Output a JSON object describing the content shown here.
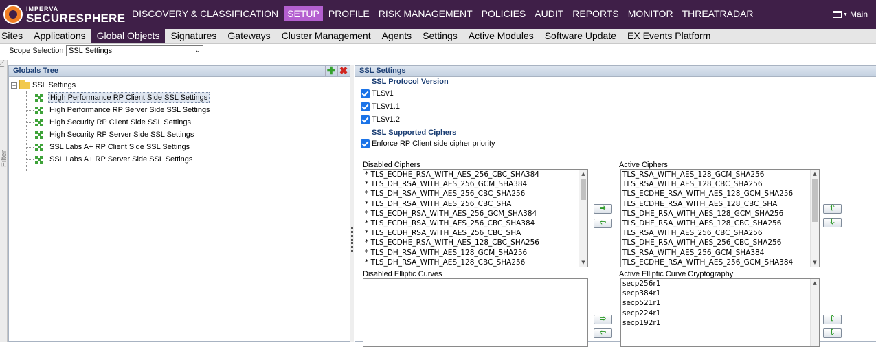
{
  "brand": {
    "top": "IMPERVA",
    "bottom": "SECURESPHERE"
  },
  "main_nav": [
    {
      "label": "DISCOVERY & CLASSIFICATION",
      "active": false
    },
    {
      "label": "SETUP",
      "active": true
    },
    {
      "label": "PROFILE",
      "active": false
    },
    {
      "label": "RISK MANAGEMENT",
      "active": false
    },
    {
      "label": "POLICIES",
      "active": false
    },
    {
      "label": "AUDIT",
      "active": false
    },
    {
      "label": "REPORTS",
      "active": false
    },
    {
      "label": "MONITOR",
      "active": false
    },
    {
      "label": "THREATRADAR",
      "active": false
    }
  ],
  "main_menu_label": "Main",
  "sub_nav": [
    {
      "label": "Sites",
      "active": false
    },
    {
      "label": "Applications",
      "active": false
    },
    {
      "label": "Global Objects",
      "active": true
    },
    {
      "label": "Signatures",
      "active": false
    },
    {
      "label": "Gateways",
      "active": false
    },
    {
      "label": "Cluster Management",
      "active": false
    },
    {
      "label": "Agents",
      "active": false
    },
    {
      "label": "Settings",
      "active": false
    },
    {
      "label": "Active Modules",
      "active": false
    },
    {
      "label": "Software Update",
      "active": false
    },
    {
      "label": "EX Events Platform",
      "active": false
    }
  ],
  "scope": {
    "label": "Scope Selection",
    "value": "SSL Settings"
  },
  "filter_label": "Filter",
  "tree_panel": {
    "title": "Globals Tree",
    "root": "SSL Settings",
    "items": [
      "High Performance RP Client Side SSL Settings",
      "High Performance RP Server Side SSL Settings",
      "High Security RP Client Side SSL Settings",
      "High Security RP Server Side SSL Settings",
      "SSL Labs A+ RP Client Side SSL Settings",
      "SSL Labs A+ RP Server Side SSL Settings"
    ],
    "selected_index": 0
  },
  "settings_panel": {
    "title": "SSL Settings",
    "protocol_section": "SSL Protocol Version",
    "protocols": [
      {
        "label": "TLSv1",
        "checked": true
      },
      {
        "label": "TLSv1.1",
        "checked": true
      },
      {
        "label": "TLSv1.2",
        "checked": true
      }
    ],
    "ciphers_section": "SSL Supported Ciphers",
    "enforce_label": "Enforce RP Client side cipher priority",
    "enforce_checked": true,
    "disabled_ciphers_label": "Disabled Ciphers",
    "disabled_ciphers": [
      "* TLS_ECDHE_RSA_WITH_AES_256_CBC_SHA384",
      "* TLS_DH_RSA_WITH_AES_256_GCM_SHA384",
      "* TLS_DH_RSA_WITH_AES_256_CBC_SHA256",
      "* TLS_DH_RSA_WITH_AES_256_CBC_SHA",
      "* TLS_ECDH_RSA_WITH_AES_256_GCM_SHA384",
      "* TLS_ECDH_RSA_WITH_AES_256_CBC_SHA384",
      "* TLS_ECDH_RSA_WITH_AES_256_CBC_SHA",
      "* TLS_ECDHE_RSA_WITH_AES_128_CBC_SHA256",
      "* TLS_DH_RSA_WITH_AES_128_GCM_SHA256",
      "* TLS_DH_RSA_WITH_AES_128_CBC_SHA256"
    ],
    "active_ciphers_label": "Active Ciphers",
    "active_ciphers": [
      "TLS_RSA_WITH_AES_128_GCM_SHA256",
      "TLS_RSA_WITH_AES_128_CBC_SHA256",
      "TLS_ECDHE_RSA_WITH_AES_128_GCM_SHA256",
      "TLS_ECDHE_RSA_WITH_AES_128_CBC_SHA",
      "TLS_DHE_RSA_WITH_AES_128_GCM_SHA256",
      "TLS_DHE_RSA_WITH_AES_128_CBC_SHA256",
      "TLS_RSA_WITH_AES_256_CBC_SHA256",
      "TLS_DHE_RSA_WITH_AES_256_CBC_SHA256",
      "TLS_RSA_WITH_AES_256_GCM_SHA384",
      "TLS_ECDHE_RSA_WITH_AES_256_GCM_SHA384"
    ],
    "disabled_curves_label": "Disabled Elliptic Curves",
    "disabled_curves": [],
    "active_curves_label": "Active Elliptic Curve Cryptography",
    "active_curves": [
      "secp256r1",
      "secp384r1",
      "secp521r1",
      "secp224r1",
      "secp192r1"
    ]
  },
  "icons": {
    "move_right": "arrow-right-icon",
    "move_left": "arrow-left-icon",
    "move_up": "arrow-up-icon",
    "move_down": "arrow-down-icon"
  },
  "colors": {
    "top_bar": "#3f1f48",
    "active_main_nav": "#b45fd0",
    "active_sub_nav": "#3f1f48",
    "panel_title": "#1a3d73",
    "checkbox": "#1a73e8"
  }
}
